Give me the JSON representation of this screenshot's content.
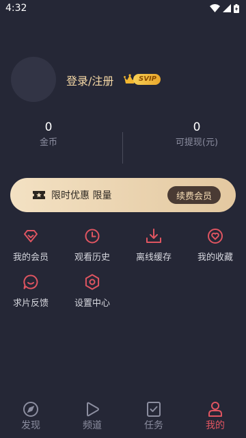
{
  "status_bar": {
    "time": "4:32"
  },
  "profile": {
    "login_label": "登录/注册",
    "badge": "SVIP"
  },
  "stats": [
    {
      "value": "0",
      "label": "金币"
    },
    {
      "value": "0",
      "label": "可提现(元)"
    }
  ],
  "vip_banner": {
    "text": "限时优惠 限量",
    "button": "续费会员"
  },
  "menu": [
    {
      "label": "我的会员",
      "icon": "diamond-icon"
    },
    {
      "label": "观看历史",
      "icon": "clock-icon"
    },
    {
      "label": "离线缓存",
      "icon": "download-icon"
    },
    {
      "label": "我的收藏",
      "icon": "heart-icon"
    },
    {
      "label": "求片反馈",
      "icon": "chat-icon"
    },
    {
      "label": "设置中心",
      "icon": "settings-icon"
    }
  ],
  "bottom_nav": [
    {
      "label": "发现",
      "icon": "compass-icon"
    },
    {
      "label": "频道",
      "icon": "play-icon"
    },
    {
      "label": "任务",
      "icon": "task-icon"
    },
    {
      "label": "我的",
      "icon": "user-icon",
      "active": true
    }
  ],
  "colors": {
    "accent": "#e05561",
    "gold": "#f6d9a6",
    "background": "#252736"
  }
}
